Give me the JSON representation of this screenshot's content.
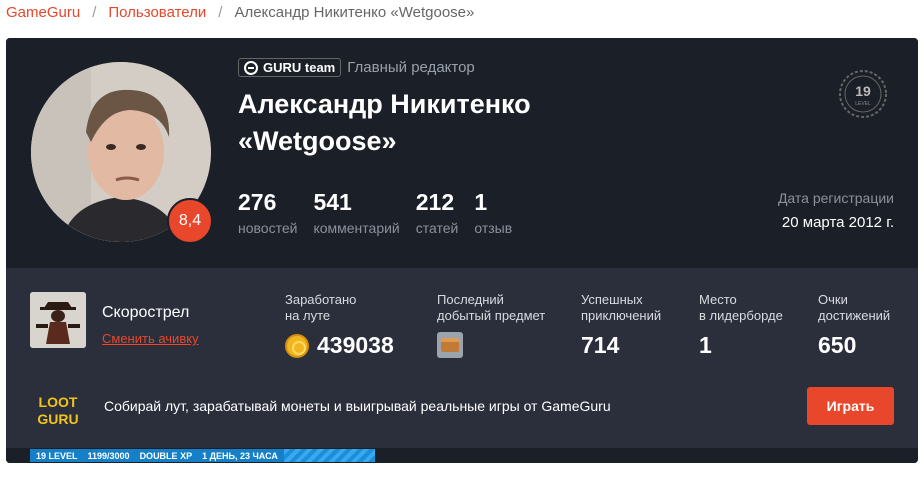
{
  "breadcrumb": {
    "home": "GameGuru",
    "sep1": "/",
    "section": "Пользователи",
    "sep2": "/",
    "current": "Александр Никитенко «Wetgoose»"
  },
  "profile": {
    "team_badge": "GURU team",
    "role": "Главный редактор",
    "name": "Александр Никитенко «Wetgoose»",
    "rating": "8,4",
    "level": "19",
    "level_word": "LEVEL",
    "stats": [
      {
        "value": "276",
        "label": "новостей"
      },
      {
        "value": "541",
        "label": "комментарий"
      },
      {
        "value": "212",
        "label": "статей"
      },
      {
        "value": "1",
        "label": "отзыв"
      }
    ],
    "registration": {
      "label": "Дата регистрации",
      "value": "20 марта 2012 г."
    }
  },
  "loot": {
    "achievement_name": "Скорострел",
    "change_achievement": "Сменить ачивку",
    "earned": {
      "label1": "Заработано",
      "label2": "на луте",
      "value": "439038"
    },
    "last_item": {
      "label1": "Последний",
      "label2": "добытый предмет"
    },
    "adventures": {
      "label1": "Успешных",
      "label2": "приключений",
      "value": "714"
    },
    "leaderboard": {
      "label1": "Место",
      "label2": "в лидерборде",
      "value": "1"
    },
    "points": {
      "label1": "Очки",
      "label2": "достижений",
      "value": "650"
    },
    "promo_text": "Собирай лут, зарабатывай монеты и выигрывай реальные игры от GameGuru",
    "play_button": "Играть",
    "logo_top": "LOOT",
    "logo_bottom": "GURU"
  },
  "xp": {
    "level": "19 LEVEL",
    "progress": "1199/3000",
    "fraction": 0.3997,
    "bonus": "DOUBLE XP",
    "bonus_time": "1 ДЕНЬ, 23 ЧАСА"
  },
  "colors": {
    "accent": "#e8472b",
    "card_dark": "#1b1f27",
    "card_panel": "#2b2f3b",
    "xp_blue": "#1a8ed8"
  }
}
